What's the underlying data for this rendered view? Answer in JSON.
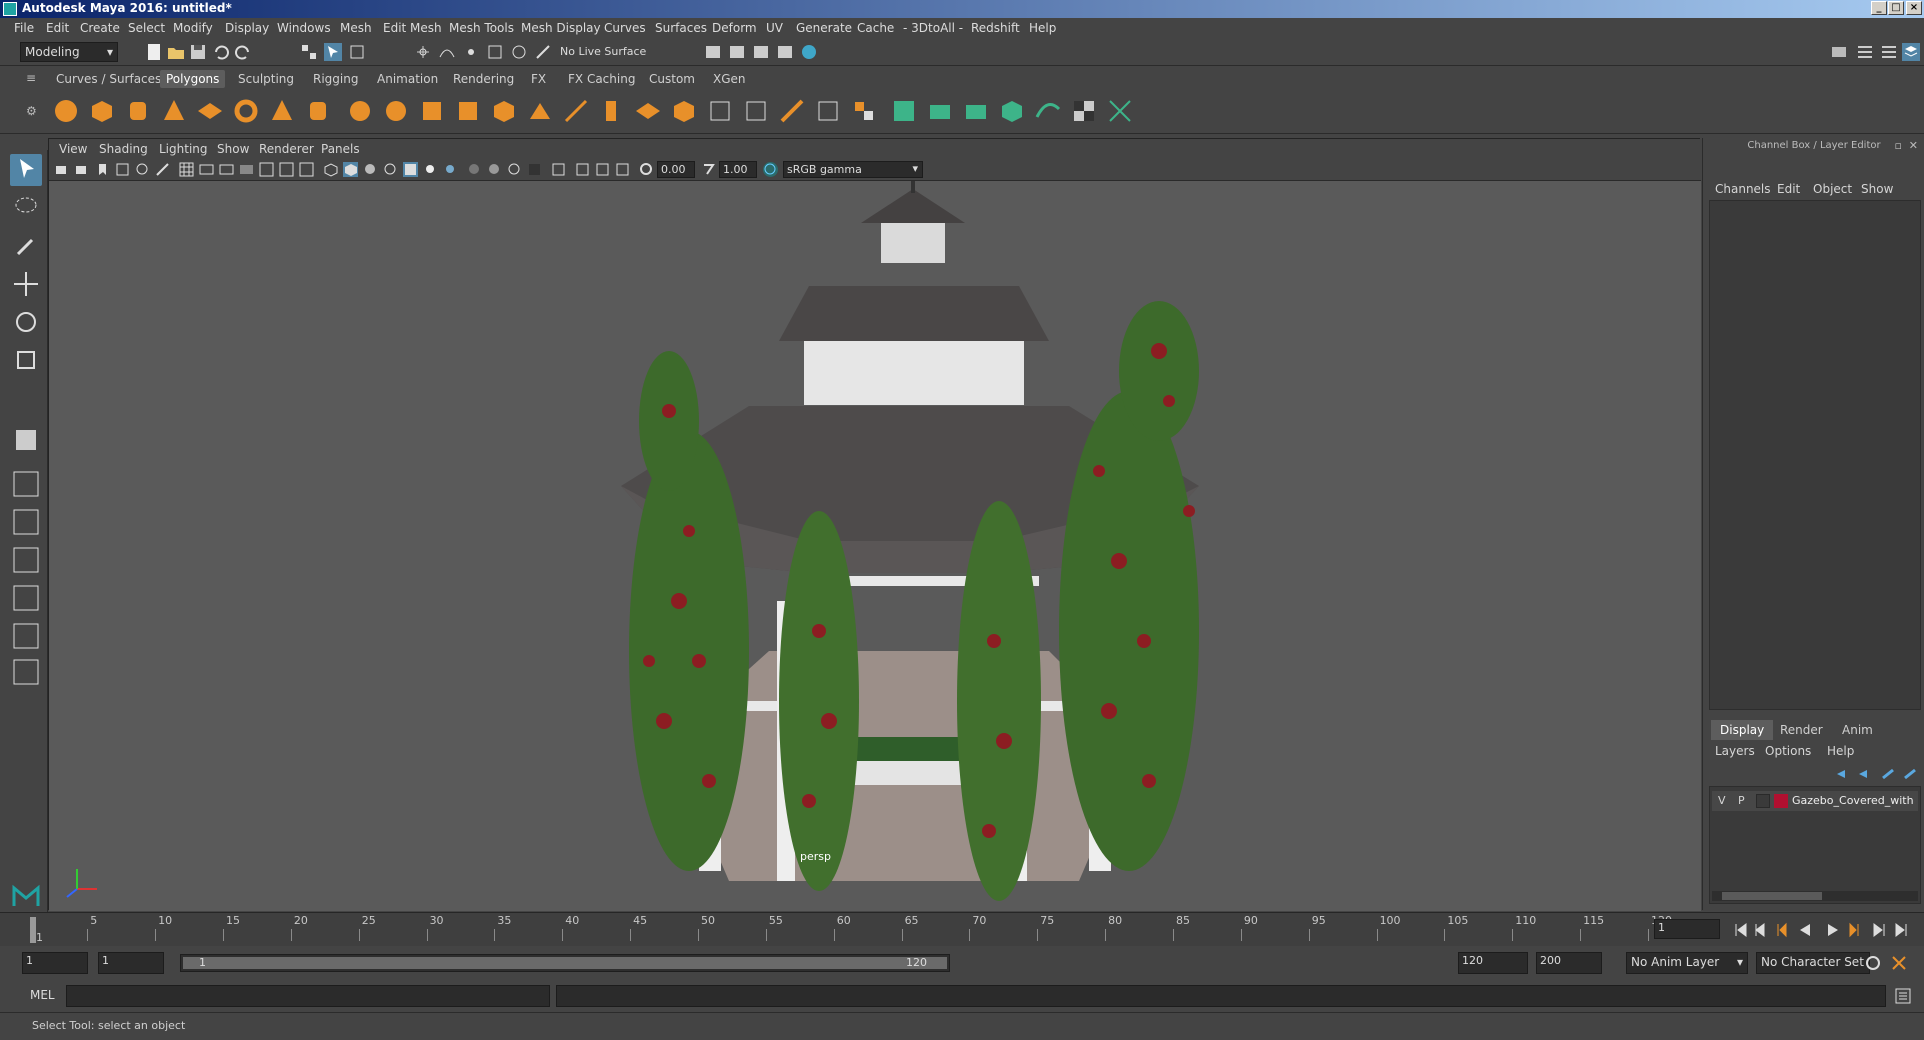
{
  "window": {
    "title": "Autodesk Maya 2016: untitled*"
  },
  "menus": [
    "File",
    "Edit",
    "Create",
    "Select",
    "Modify",
    "Display",
    "Windows",
    "Mesh",
    "Edit Mesh",
    "Mesh Tools",
    "Mesh Display",
    "Curves",
    "Surfaces",
    "Deform",
    "UV",
    "Generate",
    "Cache",
    "- 3DtoAll -",
    "Redshift",
    "Help"
  ],
  "status_line": {
    "mode": "Modeling",
    "live_surface": "No Live Surface"
  },
  "shelf_tabs": [
    "Curves / Surfaces",
    "Polygons",
    "Sculpting",
    "Rigging",
    "Animation",
    "Rendering",
    "FX",
    "FX Caching",
    "Custom",
    "XGen"
  ],
  "shelf_active": "Polygons",
  "panel_menus": [
    "View",
    "Shading",
    "Lighting",
    "Show",
    "Renderer",
    "Panels"
  ],
  "panel_toolbar": {
    "exposure": "0.00",
    "gamma": "1.00",
    "color_space": "sRGB gamma"
  },
  "viewport": {
    "camera_label": "persp"
  },
  "channel_box": {
    "title": "Channel Box / Layer Editor",
    "menus": [
      "Channels",
      "Edit",
      "Object",
      "Show"
    ]
  },
  "layer_editor": {
    "tabs": [
      "Display",
      "Render",
      "Anim"
    ],
    "active_tab": "Display",
    "menus": [
      "Layers",
      "Options",
      "Help"
    ],
    "layers": [
      {
        "v": "V",
        "p": "P",
        "name": "Gazebo_Covered_with",
        "color": "#b01030"
      }
    ]
  },
  "time_slider": {
    "ticks": [
      "1",
      "5",
      "10",
      "15",
      "20",
      "25",
      "30",
      "35",
      "40",
      "45",
      "50",
      "55",
      "60",
      "65",
      "70",
      "75",
      "80",
      "85",
      "90",
      "95",
      "100",
      "105",
      "110",
      "115",
      "120"
    ],
    "current_frame": "1"
  },
  "range_slider": {
    "start": "1",
    "playback_start": "1",
    "range_start_label": "1",
    "range_end_label": "120",
    "playback_end": "120",
    "end": "200",
    "anim_layer": "No Anim Layer",
    "character_set": "No Character Set"
  },
  "command_line": {
    "language": "MEL"
  },
  "help_line": {
    "text": "Select Tool: select an object"
  }
}
